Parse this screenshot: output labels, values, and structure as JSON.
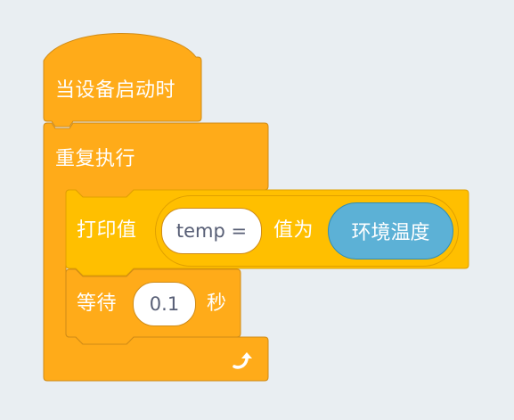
{
  "blocks": {
    "hat": {
      "label": "当设备启动时"
    },
    "repeat": {
      "label": "重复执行",
      "loop_icon": "loop-arrow-icon"
    },
    "print": {
      "label": "打印值",
      "join_prefix": "temp =",
      "join_middle": "值为",
      "variable": "环境温度"
    },
    "wait": {
      "label": "等待",
      "value": "0.1",
      "unit": "秒"
    }
  },
  "colors": {
    "control": "#ffab19",
    "control_border": "#cf8b17",
    "operator": "#ffbf00",
    "variable": "#5cb1d6",
    "background": "#e9eef2"
  }
}
